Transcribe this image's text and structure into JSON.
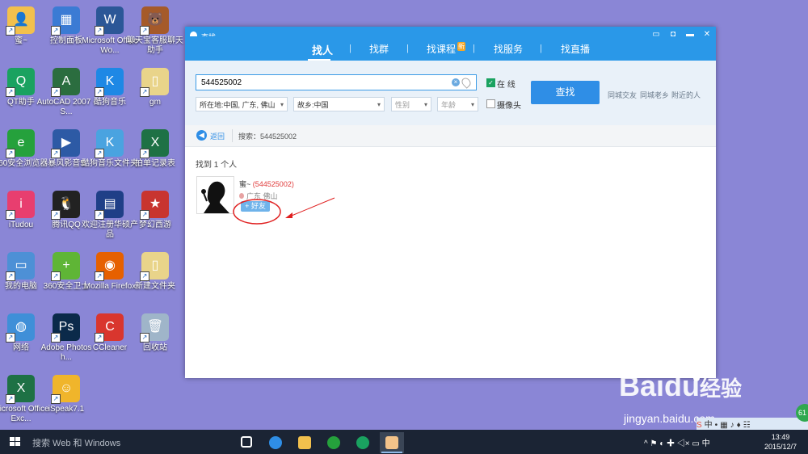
{
  "desktop": {
    "icons": [
      {
        "label": "蜜~",
        "color": "#f2c04d",
        "glyph": "👤"
      },
      {
        "label": "控制面板",
        "color": "#3b7bd4",
        "glyph": "▦"
      },
      {
        "label": "Microsoft Office Wo...",
        "color": "#2b5797",
        "glyph": "W"
      },
      {
        "label": "聊天宝客服聊天助手",
        "color": "#a55a2a",
        "glyph": "🐻"
      },
      {
        "label": "QT助手",
        "color": "#1aa260",
        "glyph": "Q"
      },
      {
        "label": "AutoCAD 2007 - S...",
        "color": "#2b6d3f",
        "glyph": "A"
      },
      {
        "label": "酷狗音乐",
        "color": "#1e88e5",
        "glyph": "K"
      },
      {
        "label": "gm",
        "color": "#e9d48a",
        "glyph": "▯"
      },
      {
        "label": "360安全浏览器",
        "color": "#25a13c",
        "glyph": "e"
      },
      {
        "label": "暴风影音5",
        "color": "#2d5aa5",
        "glyph": "▶"
      },
      {
        "label": "酷狗音乐文件夹",
        "color": "#4aa3e0",
        "glyph": "K"
      },
      {
        "label": "拍单记录表",
        "color": "#1e7145",
        "glyph": "X"
      },
      {
        "label": "iTudou",
        "color": "#e83e6f",
        "glyph": "i"
      },
      {
        "label": "腾讯QQ",
        "color": "#222222",
        "glyph": "🐧"
      },
      {
        "label": "欢迎注册华硕产品",
        "color": "#1f3f87",
        "glyph": "▤"
      },
      {
        "label": "梦幻西游",
        "color": "#c8342f",
        "glyph": "★"
      },
      {
        "label": "我的电脑",
        "color": "#4d90d6",
        "glyph": "▭"
      },
      {
        "label": "360安全卫士",
        "color": "#5fb536",
        "glyph": "+"
      },
      {
        "label": "Mozilla Firefox",
        "color": "#e66000",
        "glyph": "◉"
      },
      {
        "label": "新建文件夹",
        "color": "#e9d48a",
        "glyph": "▯"
      },
      {
        "label": "网络",
        "color": "#3f8fd8",
        "glyph": "◍"
      },
      {
        "label": "Adobe Photosh...",
        "color": "#0b2a4a",
        "glyph": "Ps"
      },
      {
        "label": "CCleaner",
        "color": "#d9362e",
        "glyph": "C"
      },
      {
        "label": "回收站",
        "color": "#9fb5c9",
        "glyph": "🗑"
      },
      {
        "label": "Microsoft Office Exc...",
        "color": "#1e7145",
        "glyph": "X"
      },
      {
        "label": "iSpeak7.1",
        "color": "#f0b52b",
        "glyph": "☺"
      }
    ]
  },
  "window": {
    "title": "查找",
    "controls": {
      "feedback": "▭",
      "skin": "◘",
      "minimize": "▬",
      "close": "✕"
    },
    "tabs": [
      {
        "label": "找人",
        "active": true
      },
      {
        "label": "找群"
      },
      {
        "label": "找课程",
        "badge": "新"
      },
      {
        "label": "找服务"
      },
      {
        "label": "找直播"
      }
    ],
    "search": {
      "value": "544525002",
      "location": "所在地:中国, 广东, 佛山",
      "hometown": "故乡:中国",
      "gender": "性别",
      "age": "年龄",
      "online_label": "在  线",
      "camera_label": "摄像头",
      "button": "查找",
      "quick_links": [
        "同城交友",
        "同城老乡",
        "附近的人"
      ]
    },
    "breadcrumb": {
      "back": "返回",
      "search_label": "搜索：",
      "query": "544525002"
    },
    "results": {
      "count_text": "找到 1 个人",
      "items": [
        {
          "name": "蜜~",
          "id": "(544525002)",
          "location": "广东  佛山",
          "add_label": "+ 好友"
        }
      ]
    }
  },
  "watermark": {
    "brand": "Bai",
    "brand2": "du",
    "suffix": "经验",
    "url": "jingyan.baidu.com"
  },
  "float_ball": "61",
  "taskbar": {
    "search_placeholder": "搜索 Web 和 Windows",
    "tray": "^  ⚑  ◐  ✚  ◁×  ▭  中",
    "time": "13:49",
    "date": "2015/12/7"
  }
}
